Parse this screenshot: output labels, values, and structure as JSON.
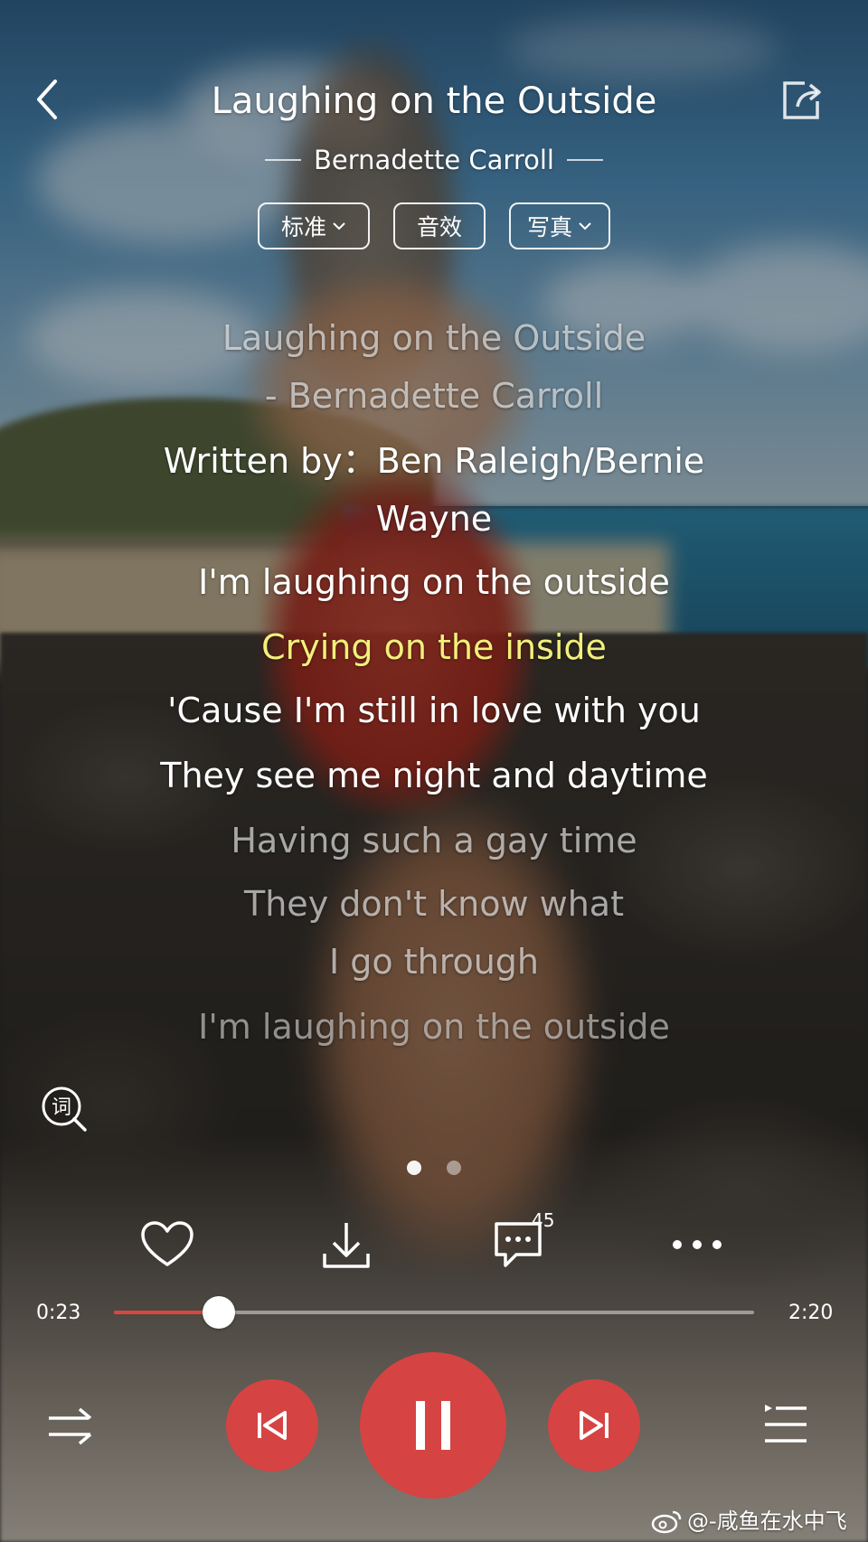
{
  "header": {
    "title": "Laughing on the Outside",
    "artist": "Bernadette Carroll"
  },
  "pills": [
    {
      "label": "标准",
      "has_dropdown": true
    },
    {
      "label": "音效",
      "has_dropdown": false
    },
    {
      "label": "写真",
      "has_dropdown": true
    }
  ],
  "lyrics": [
    "Laughing on the Outside",
    "- Bernadette Carroll",
    "Written by：Ben Raleigh/Bernie",
    "Wayne",
    "I'm laughing on the outside",
    "Crying on the inside",
    "'Cause I'm still in love with you",
    "They see me night and daytime",
    "Having such a gay time",
    "They don't know what",
    "I go through",
    "I'm laughing on the outside"
  ],
  "current_lyric_index": 5,
  "pager": {
    "pages": 2,
    "active": 0
  },
  "actions": {
    "like_icon": "heart-icon",
    "download_icon": "download-icon",
    "comment_icon": "comment-icon",
    "comment_count": "45",
    "more_icon": "more-icon",
    "lyric_search_icon": "lyric-search-icon",
    "lyric_search_char": "词"
  },
  "progress": {
    "current": "0:23",
    "total": "2:20",
    "fraction": 0.164
  },
  "controls": {
    "mode_icon": "shuffle-icon",
    "prev_icon": "previous-icon",
    "play_icon": "pause-icon",
    "next_icon": "next-icon",
    "list_icon": "playlist-icon"
  },
  "colors": {
    "accent": "#d64343",
    "current_lyric": "#f2f07a"
  },
  "watermark": "@-咸鱼在水中飞"
}
